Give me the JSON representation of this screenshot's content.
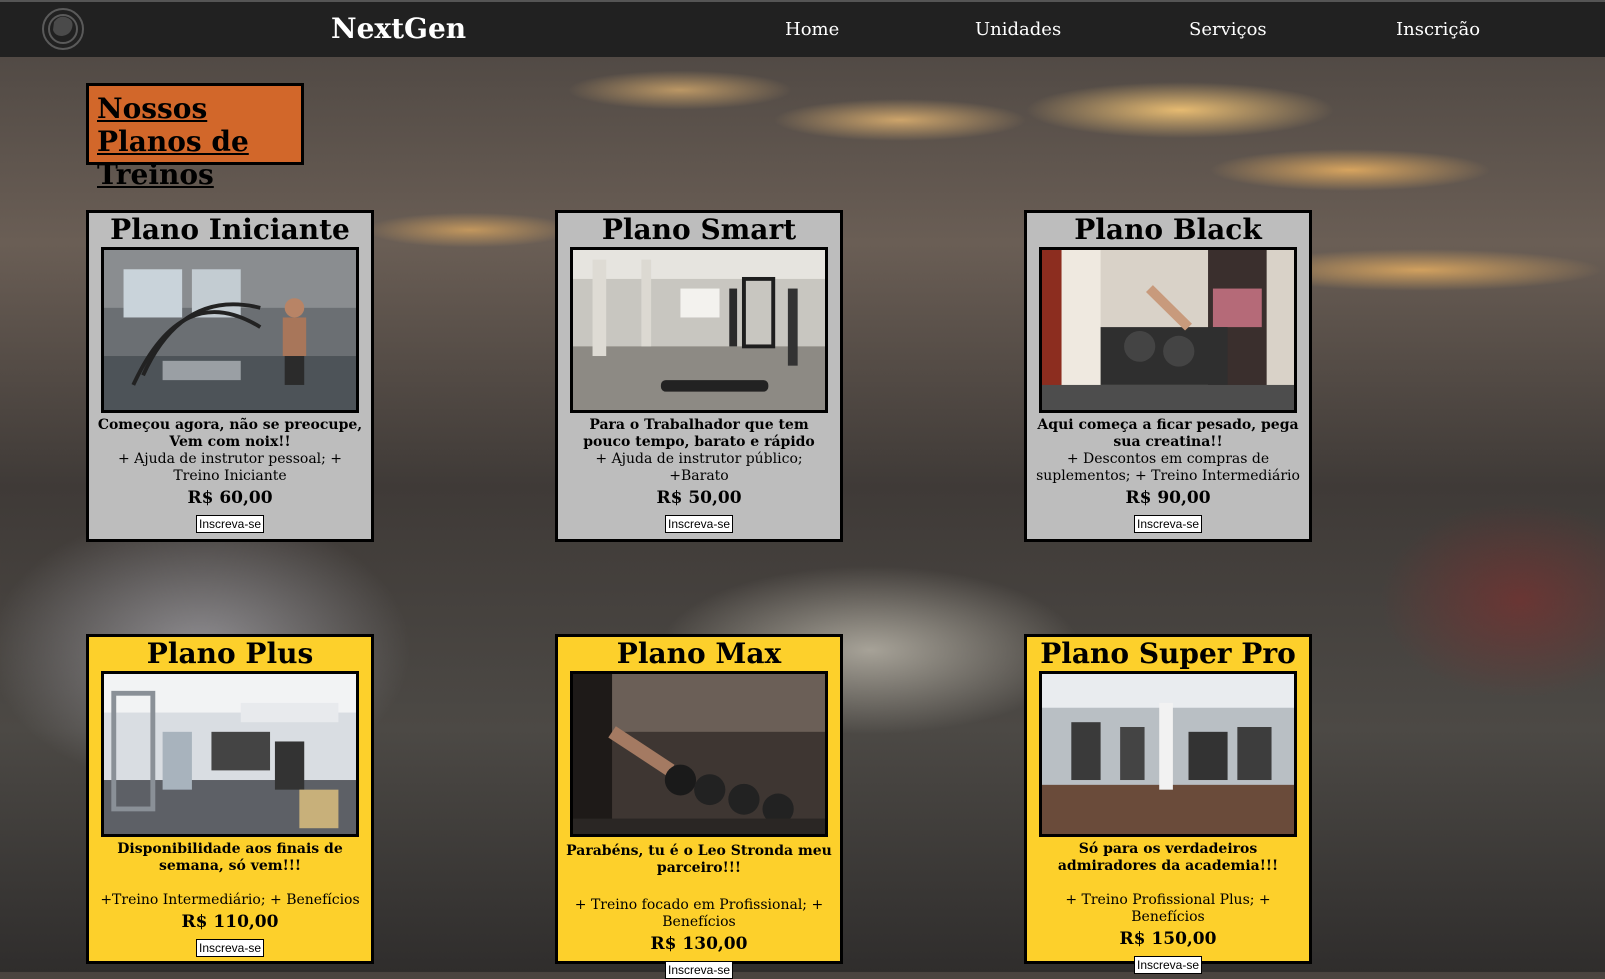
{
  "nav": {
    "brand": "NextGen",
    "logo_icon": "fist-logo-icon",
    "links": [
      "Home",
      "Unidades",
      "Serviços",
      "Inscrição"
    ]
  },
  "section_title": "Nossos Planos de Treinos",
  "plans": [
    {
      "name": "Plano Iniciante",
      "image": "battle-ropes-gym-photo",
      "description": "Começou agora, não se preocupe, Vem com noix!!",
      "benefits": "+ Ajuda de instrutor pessoal; + Treino Iniciante",
      "price": "R$ 60,00",
      "button": "Inscreva-se"
    },
    {
      "name": "Plano Smart",
      "image": "gym-room-photo",
      "description": "Para o Trabalhador que tem pouco tempo, barato e rápido",
      "benefits": "+ Ajuda de instrutor público; +Barato",
      "price": "R$ 50,00",
      "button": "Inscreva-se"
    },
    {
      "name": "Plano Black",
      "image": "dumbbell-rack-photo",
      "description": "Aqui começa a ficar pesado, pega sua creatina!!",
      "benefits": "+ Descontos em compras de suplementos; + Treino Intermediário",
      "price": "R$ 90,00",
      "button": "Inscreva-se"
    },
    {
      "name": "Plano Plus",
      "image": "machines-room-photo",
      "description": "Disponibilidade aos finais de semana, só vem!!!",
      "benefits": "+Treino Intermediário; + Benefícios",
      "price": "R$ 110,00",
      "button": "Inscreva-se"
    },
    {
      "name": "Plano Max",
      "image": "dumbbells-photo",
      "description": "Parabéns, tu é o Leo Stronda meu parceiro!!!",
      "benefits": "+ Treino focado em Profissional; + Benefícios",
      "price": "R$ 130,00",
      "button": "Inscreva-se"
    },
    {
      "name": "Plano Super Pro",
      "image": "large-gym-photo",
      "description": "Só para os verdadeiros admiradores da academia!!!",
      "benefits": "+ Treino Profissional Plus; + Benefícios",
      "price": "R$ 150,00",
      "button": "Inscreva-se"
    }
  ]
}
